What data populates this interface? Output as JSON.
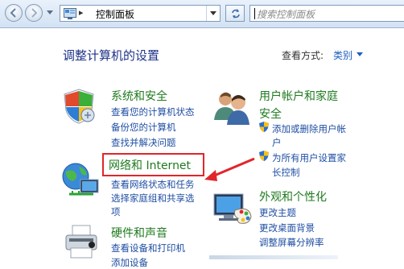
{
  "address_bar": {
    "path_label": "控制面板",
    "separator": "▸",
    "search_placeholder": "搜索控制面板"
  },
  "header": {
    "title": "调整计算机的设置",
    "view_by_label": "查看方式:",
    "view_by_value": "类别"
  },
  "categories": {
    "system_security": {
      "title": "系统和安全",
      "tasks": [
        "查看您的计算机状态",
        "备份您的计算机",
        "查找并解决问题"
      ]
    },
    "network_internet": {
      "title": "网络和 Internet",
      "tasks": [
        "查看网络状态和任务",
        "选择家庭组和共享选",
        "项"
      ]
    },
    "hardware_sound": {
      "title": "硬件和声音",
      "tasks": [
        "查看设备和打印机",
        "添加设备"
      ]
    },
    "user_accounts": {
      "title_line1": "用户帐户和家庭",
      "title_line2": "安全",
      "tasks": [
        "添加或删除用户帐",
        "户",
        "为所有用户设置家",
        "长控制"
      ]
    },
    "appearance": {
      "title": "外观和个性化",
      "tasks": [
        "更改主题",
        "更改桌面背景",
        "调整屏幕分辨率"
      ]
    }
  },
  "colors": {
    "category_title": "#1f7a1f",
    "task_link": "#1f4ea3",
    "page_title": "#1e3287",
    "annotation": "#e0262b"
  },
  "icons": {
    "back": "back-arrow-icon",
    "forward": "forward-arrow-icon",
    "control_panel": "control-panel-icon",
    "refresh": "refresh-icon",
    "system_security": "shield-icon",
    "user_accounts": "users-icon",
    "network": "network-globe-icon",
    "appearance": "monitor-palette-icon",
    "hardware": "printer-icon",
    "uac": "uac-shield-icon"
  }
}
